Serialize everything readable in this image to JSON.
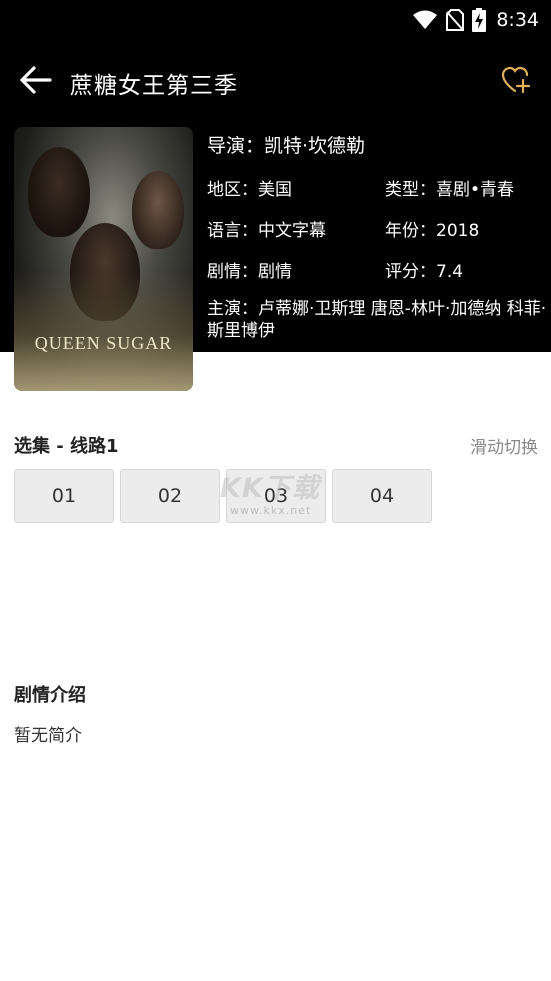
{
  "status_bar": {
    "time": "8:34"
  },
  "appbar": {
    "title": "蔗糖女王第三季"
  },
  "poster": {
    "title": "QUEEN SUGAR"
  },
  "info": {
    "director": "导演：凯特·坎德勒",
    "region": "地区：美国",
    "genre": "类型：喜剧•青春",
    "language": "语言：中文字幕",
    "year": "年份：2018",
    "plot": "剧情：剧情",
    "rating": "评分：7.4",
    "cast": "主演：卢蒂娜·卫斯理  唐恩-林叶·加德纳  科菲·斯里博伊"
  },
  "episodes": {
    "title": "选集 - 线路1",
    "swipe_label": "滑动切换",
    "items": [
      "01",
      "02",
      "03",
      "04"
    ]
  },
  "watermark": {
    "logo": "KK下载",
    "url": "www.kkx.net"
  },
  "synopsis": {
    "title": "剧情介绍",
    "text": "暂无简介"
  },
  "colors": {
    "header_bg": "#000000",
    "accent_heart": "#e0b15a",
    "episode_bg": "#ececec"
  },
  "icons": [
    "wifi-icon",
    "no-sim-icon",
    "battery-charging-icon",
    "back-arrow-icon",
    "heart-plus-icon"
  ]
}
